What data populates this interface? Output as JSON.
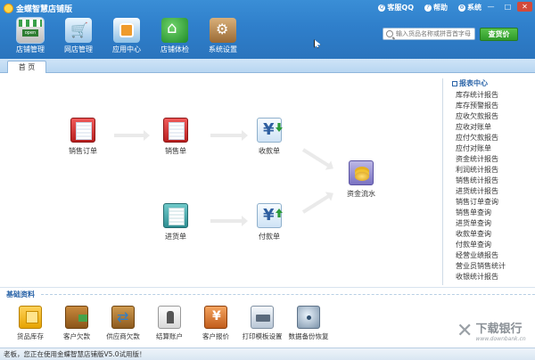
{
  "app": {
    "title": "金蝶智慧店铺版"
  },
  "window_tools": {
    "support": "客服QQ",
    "help": "帮助",
    "system": "系统"
  },
  "window_controls": {
    "minimize": "—",
    "maximize": "□",
    "close": "✕"
  },
  "nav": [
    {
      "label": "店铺管理",
      "icon": "storefront-icon"
    },
    {
      "label": "网店管理",
      "icon": "shopping-cart-icon"
    },
    {
      "label": "应用中心",
      "icon": "app-center-icon"
    },
    {
      "label": "店铺体检",
      "icon": "health-check-icon"
    },
    {
      "label": "系统设置",
      "icon": "toolbox-icon"
    }
  ],
  "search": {
    "placeholder": "输入货品名称或拼音首字母",
    "button": "查货价"
  },
  "tabs": [
    {
      "label": "首 页"
    }
  ],
  "flow": {
    "sales_order": "销售订单",
    "sales_slip": "销售单",
    "receipt": "收款单",
    "purchase_in": "进货单",
    "payment": "付款单",
    "cash_flow": "资金流水"
  },
  "report": {
    "title": "报表中心",
    "items": [
      "库存统计报告",
      "库存预警报告",
      "应收欠款报告",
      "应收对账单",
      "应付欠款报告",
      "应付对账单",
      "资金统计报告",
      "利润统计报告",
      "销售统计报告",
      "进货统计报告",
      "销售订单查询",
      "销售单查询",
      "进货单查询",
      "收款单查询",
      "付款单查询",
      "经营业绩报告",
      "营业员销售统计",
      "收银统计报告"
    ]
  },
  "base": {
    "title": "基础资料",
    "items": [
      {
        "label": "货品库存",
        "icon": "inventory-box-icon"
      },
      {
        "label": "客户欠款",
        "icon": "wallet-icon"
      },
      {
        "label": "供应商欠款",
        "icon": "supplier-transfer-icon"
      },
      {
        "label": "结算账户",
        "icon": "account-book-icon"
      },
      {
        "label": "客户报价",
        "icon": "price-quote-icon"
      },
      {
        "label": "打印模板设置",
        "icon": "printer-icon"
      },
      {
        "label": "数据备份恢复",
        "icon": "backup-restore-icon"
      }
    ]
  },
  "status": {
    "text": "老板，您正在使用金蝶智慧店铺版V5.0试用版！"
  },
  "watermark": {
    "name": "下载银行",
    "url": "www.downbank.cn"
  },
  "colors": {
    "header": "#2f7fcb",
    "accent_green": "#2f9a2a",
    "link_blue": "#2a64a8"
  }
}
